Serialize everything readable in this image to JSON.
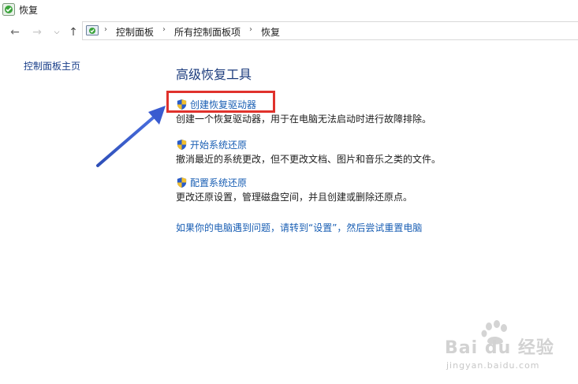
{
  "window": {
    "title": "恢复"
  },
  "nav": {
    "back_icon": "back-arrow-icon",
    "forward_icon": "forward-arrow-icon",
    "recent_icon": "chevron-down-icon",
    "up_icon": "up-arrow-icon"
  },
  "breadcrumb": {
    "items": [
      "控制面板",
      "所有控制面板项",
      "恢复"
    ]
  },
  "sidebar": {
    "home_link": "控制面板主页"
  },
  "main": {
    "section_title": "高级恢复工具",
    "tasks": [
      {
        "label": "创建恢复驱动器",
        "description": "创建一个恢复驱动器，用于在电脑无法启动时进行故障排除。"
      },
      {
        "label": "开始系统还原",
        "description": "撤消最近的系统更改，但不更改文档、图片和音乐之类的文件。"
      },
      {
        "label": "配置系统还原",
        "description": "更改还原设置，管理磁盘空间，并且创建或删除还原点。"
      }
    ],
    "reset_link": "如果你的电脑遇到问题，请转到“设置”，然后尝试重置电脑"
  },
  "annotation": {
    "box_color": "#e0322c",
    "arrow_color": "#3a5bd0"
  },
  "watermark": {
    "brand": "Bai du 经验",
    "url": "jingyan.baidu.com"
  },
  "colors": {
    "link": "#1a5fb4",
    "title": "#1a3a7c"
  }
}
